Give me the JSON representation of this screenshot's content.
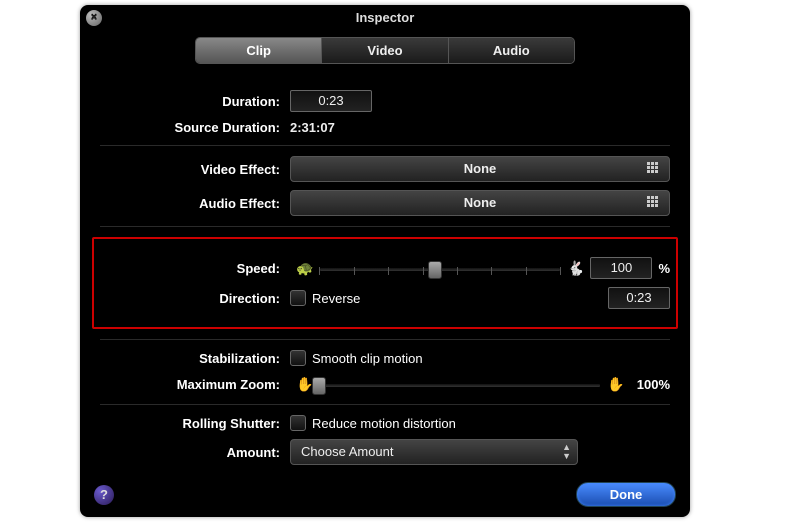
{
  "window": {
    "title": "Inspector"
  },
  "tabs": {
    "items": [
      "Clip",
      "Video",
      "Audio"
    ],
    "active": 0
  },
  "duration": {
    "label": "Duration:",
    "value": "0:23"
  },
  "sourceDuration": {
    "label": "Source Duration:",
    "value": "2:31:07"
  },
  "videoEffect": {
    "label": "Video Effect:",
    "value": "None"
  },
  "audioEffect": {
    "label": "Audio Effect:",
    "value": "None"
  },
  "speed": {
    "label": "Speed:",
    "value": "100",
    "unit": "%",
    "sliderPercent": 48
  },
  "direction": {
    "label": "Direction:",
    "checkboxLabel": "Reverse",
    "checked": false,
    "time": "0:23"
  },
  "stabilization": {
    "label": "Stabilization:",
    "checkboxLabel": "Smooth clip motion",
    "checked": false
  },
  "maxZoom": {
    "label": "Maximum Zoom:",
    "value": "100%",
    "sliderPercent": 0
  },
  "rollingShutter": {
    "label": "Rolling Shutter:",
    "checkboxLabel": "Reduce motion distortion",
    "checked": false
  },
  "amount": {
    "label": "Amount:",
    "value": "Choose Amount"
  },
  "buttons": {
    "done": "Done"
  },
  "icons": {
    "turtle": "🐢",
    "rabbit": "🐇",
    "hand": "✋"
  }
}
